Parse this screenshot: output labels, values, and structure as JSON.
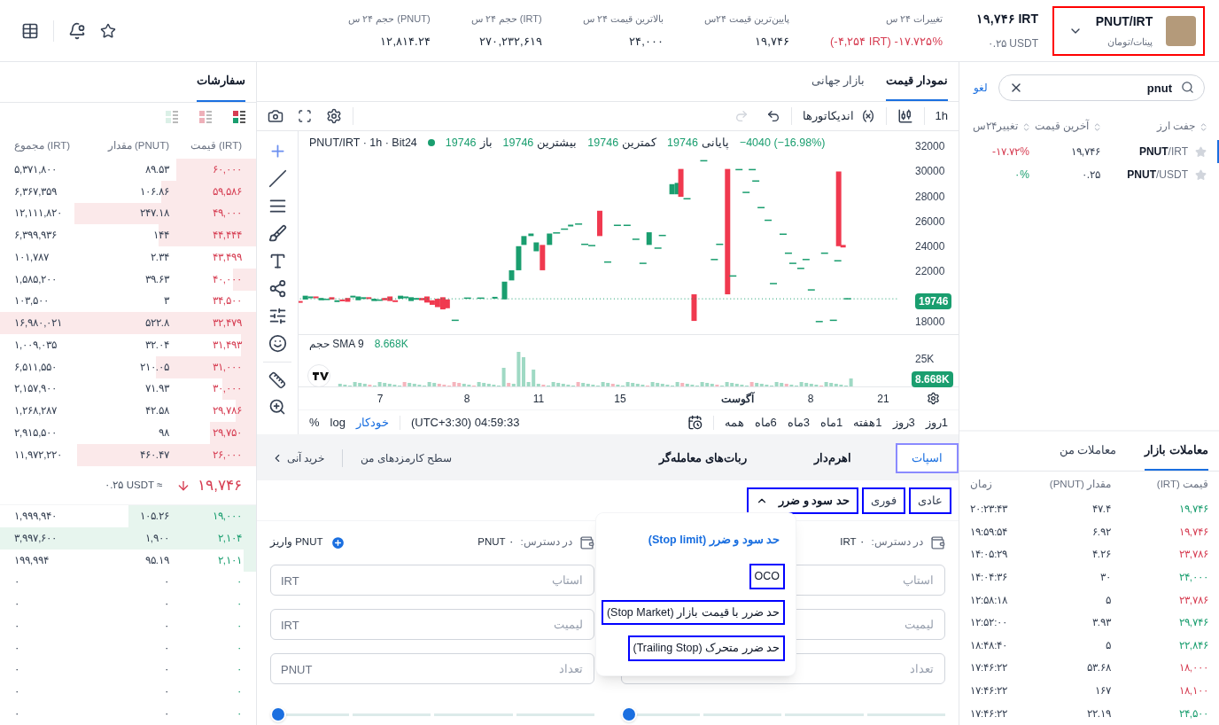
{
  "header": {
    "pair": {
      "symbol": "PNUT/IRT",
      "name": "پینات/تومان",
      "highlighted": true
    },
    "price": "۱۹,۷۴۶ IRT",
    "price_usdt": "۰.۲۵ USDT",
    "stats": [
      {
        "label": "تغییرات ۲۴ س",
        "value": "(-۴,۲۵۴ IRT) -۱۷.۷۲۵%",
        "negative": true
      },
      {
        "label": "پایین‌ترین قیمت ۲۴س",
        "value": "۱۹,۷۴۶",
        "negative": false
      },
      {
        "label": "بالاترین قیمت ۲۴ س",
        "value": "۲۴,۰۰۰",
        "negative": false
      },
      {
        "label": "حجم ۲۴ س (IRT)",
        "value": "۲۷۰,۲۳۲,۶۱۹",
        "negative": false
      },
      {
        "label": "حجم ۲۴ س (PNUT)",
        "value": "۱۲,۸۱۴.۲۴",
        "negative": false
      }
    ]
  },
  "order_book": {
    "tab": "سفارشات",
    "view_modes": [
      {
        "kind": "both",
        "selected": true
      },
      {
        "kind": "asks",
        "selected": false
      },
      {
        "kind": "bids",
        "selected": false
      }
    ],
    "columns": [
      "قیمت (IRT)",
      "مقدار (PNUT)",
      "مجموع (IRT)"
    ],
    "asks": [
      {
        "price": "۶۰,۰۰۰",
        "amount": "۸۹.۵۳",
        "total": "۵,۳۷۱,۸۰۰",
        "level": 0.31
      },
      {
        "price": "۵۹,۵۸۶",
        "amount": "۱۰۶.۸۶",
        "total": "۶,۳۶۷,۳۵۹",
        "level": 0.37
      },
      {
        "price": "۴۹,۰۰۰",
        "amount": "۲۴۷.۱۸",
        "total": "۱۲,۱۱۱,۸۲۰",
        "level": 0.71
      },
      {
        "price": "۴۴,۴۴۴",
        "amount": "۱۴۴",
        "total": "۶,۳۹۹,۹۳۶",
        "level": 0.38
      },
      {
        "price": "۴۳,۴۹۹",
        "amount": "۲.۳۴",
        "total": "۱۰۱,۷۸۷"
      },
      {
        "price": "۴۰,۰۰۰",
        "amount": "۳۹.۶۳",
        "total": "۱,۵۸۵,۲۰۰",
        "level": 0.09
      },
      {
        "price": "۳۴,۵۰۰",
        "amount": "۳",
        "total": "۱۰۳,۵۰۰"
      },
      {
        "price": "۳۲,۴۷۹",
        "amount": "۵۲۲.۸",
        "total": "۱۶,۹۸۰,۰۲۱",
        "level": 1
      },
      {
        "price": "۳۱,۴۹۳",
        "amount": "۳۲.۰۴",
        "total": "۱,۰۰۹,۰۳۵",
        "level": 0.06
      },
      {
        "price": "۳۱,۰۰۰",
        "amount": "۲۱۰.۰۵",
        "total": "۶,۵۱۱,۵۵۰",
        "level": 0.39
      },
      {
        "price": "۳۰,۰۰۰",
        "amount": "۷۱.۹۳",
        "total": "۲,۱۵۷,۹۰۰",
        "level": 0.13
      },
      {
        "price": "۲۹,۷۸۶",
        "amount": "۴۲.۵۸",
        "total": "۱,۲۶۸,۲۸۷",
        "level": 0.08
      },
      {
        "price": "۲۹,۷۵۰",
        "amount": "۹۸",
        "total": "۲,۹۱۵,۵۰۰",
        "level": 0.18
      },
      {
        "price": "۲۶,۰۰۰",
        "amount": "۴۶۰.۴۷",
        "total": "۱۱,۹۷۲,۲۲۰",
        "level": 0.7
      }
    ],
    "last_price": "۱۹,۷۴۶",
    "last_price_falling": true,
    "last_price_usdt": "۰.۲۵ USDT ≈",
    "bids": [
      {
        "price": "۱۹,۰۰۰",
        "amount": "۱۰۵.۲۶",
        "total": "۱,۹۹۹,۹۴۰",
        "level": 0.5
      },
      {
        "price": "۲,۱۰۴",
        "amount": "۱,۹۰۰",
        "total": "۳,۹۹۷,۶۰۰",
        "level": 1
      },
      {
        "price": "۲,۱۰۱",
        "amount": "۹۵.۱۹",
        "total": "۱۹۹,۹۹۴",
        "level": 0.05
      },
      {
        "price": "۰",
        "amount": "۰",
        "total": "۰"
      },
      {
        "price": "۰",
        "amount": "۰",
        "total": "۰"
      },
      {
        "price": "۰",
        "amount": "۰",
        "total": "۰"
      },
      {
        "price": "۰",
        "amount": "۰",
        "total": "۰"
      },
      {
        "price": "۰",
        "amount": "۰",
        "total": "۰"
      },
      {
        "price": "۰",
        "amount": "۰",
        "total": "۰"
      },
      {
        "price": "۰",
        "amount": "۰",
        "total": "۰"
      }
    ]
  },
  "chart_panel": {
    "tabs": [
      {
        "label": "نمودار قیمت",
        "selected": true
      },
      {
        "label": "بازار جهانی",
        "selected": false
      }
    ],
    "interval": "1h",
    "indicators": "اندیکاتورها",
    "title": "PNUT/IRT · 1h · Bit24",
    "change": "−4040 (−16.98%)",
    "ohlc": [
      {
        "label": "پایانی",
        "value": "19746"
      },
      {
        "label": "کمترین",
        "value": "19746"
      },
      {
        "label": "بیشترین",
        "value": "19746"
      },
      {
        "label": "باز",
        "value": "19746"
      }
    ],
    "price_axis": [
      "32000",
      "30000",
      "28000",
      "26000",
      "24000",
      "22000",
      "18000"
    ],
    "current_price": "19746",
    "volume_legend": "حجم SMA 9",
    "volume_value": "8.668K",
    "volume_axis": "25K",
    "volume_tag": "8.668K",
    "time_axis": [
      "21",
      "8",
      "آگوست",
      "15",
      "11",
      "8",
      "7"
    ],
    "ranges": [
      "1روز",
      "3روز",
      "1هفته",
      "1ماه",
      "3ماه",
      "6ماه",
      "همه"
    ],
    "clock": "(UTC+3:30) 04:59:33",
    "scale_options": [
      {
        "label": "خودکار",
        "selected": true
      },
      {
        "label": "log",
        "selected": false
      },
      {
        "label": "%",
        "selected": false
      }
    ]
  },
  "trade_panel": {
    "tabs": [
      {
        "label": "اسپات",
        "selected": true,
        "highlighted": true
      },
      {
        "label": "اهرم‌دار",
        "selected": false,
        "highlighted": false
      },
      {
        "label": "ربات‌های معامله‌گر",
        "selected": false,
        "highlighted": false
      }
    ],
    "links": [
      {
        "label": "سطح کارمزدهای من",
        "kind": "plain"
      },
      {
        "label": "خرید آنی",
        "kind": "arrow"
      }
    ],
    "order_types": [
      {
        "label": "عادی",
        "selected": false,
        "highlighted": true,
        "kind": "tab"
      },
      {
        "label": "فوری",
        "selected": false,
        "highlighted": true,
        "kind": "tab"
      },
      {
        "label": "حد سود و ضرر",
        "selected": true,
        "highlighted": true,
        "kind": "dropdown",
        "expanded": true
      }
    ],
    "order_menu": [
      {
        "label": "حد سود و ضرر (Stop limit)",
        "selected": true,
        "highlighted": false
      },
      {
        "label": "OCO",
        "selected": false,
        "highlighted": true
      },
      {
        "label": "حد ضرر با قیمت بازار (Stop Market)",
        "selected": false,
        "highlighted": true
      },
      {
        "label": "حد ضرر متحرک (Trailing Stop)",
        "selected": false,
        "highlighted": true
      }
    ],
    "forms": [
      {
        "available_label": "در دسترس:",
        "available": "IRT ۰",
        "fields": [
          {
            "placeholder": "استاپ"
          },
          {
            "placeholder": "لیمیت"
          },
          {
            "placeholder": "تعداد"
          }
        ],
        "level": 0
      },
      {
        "available_label": "در دسترس:",
        "available": "PNUT ۰",
        "deposit": "واریز PNUT",
        "fields": [
          {
            "placeholder": "استاپ",
            "unit": "IRT"
          },
          {
            "placeholder": "لیمیت",
            "unit": "IRT"
          },
          {
            "placeholder": "تعداد",
            "unit": "PNUT"
          }
        ],
        "level": 0
      }
    ]
  },
  "markets": {
    "search": {
      "value": "pnut"
    },
    "cancel": "لغو",
    "columns": [
      "جفت ارز",
      "آخرین قیمت",
      "تغییر۲۴س"
    ],
    "rows": [
      {
        "base": "PNUT",
        "quote": "/IRT",
        "price": "۱۹,۷۴۶",
        "change": "-۱۷.۷۲%",
        "negative": true,
        "selected": true
      },
      {
        "base": "PNUT",
        "quote": "/USDT",
        "price": "۰.۲۵",
        "change": "۰%",
        "negative": false,
        "selected": false
      }
    ]
  },
  "trades": {
    "tabs": [
      {
        "label": "معاملات بازار",
        "selected": true
      },
      {
        "label": "معاملات من",
        "selected": false
      }
    ],
    "columns": [
      "قیمت (IRT)",
      "مقدار (PNUT)",
      "زمان"
    ],
    "rows": [
      {
        "price": "۱۹,۷۴۶",
        "amount": "۴۷.۴",
        "time": "۲۰:۲۳:۴۳",
        "sell": false
      },
      {
        "price": "۱۹,۷۴۶",
        "amount": "۶.۹۲",
        "time": "۱۹:۵۹:۵۴",
        "sell": true
      },
      {
        "price": "۲۳,۷۸۶",
        "amount": "۴.۲۶",
        "time": "۱۴:۰۵:۲۹",
        "sell": true
      },
      {
        "price": "۲۴,۰۰۰",
        "amount": "۳۰",
        "time": "۱۴:۰۴:۳۶",
        "sell": false
      },
      {
        "price": "۲۳,۷۸۶",
        "amount": "۵",
        "time": "۱۲:۵۸:۱۸",
        "sell": true
      },
      {
        "price": "۲۹,۷۴۶",
        "amount": "۳.۹۳",
        "time": "۱۲:۵۲:۰۰",
        "sell": false
      },
      {
        "price": "۲۲,۸۴۶",
        "amount": "۵",
        "time": "۱۸:۴۸:۴۰",
        "sell": false
      },
      {
        "price": "۱۸,۰۰۰",
        "amount": "۵۳.۶۸",
        "time": "۱۷:۴۶:۲۲",
        "sell": true
      },
      {
        "price": "۱۸,۱۰۰",
        "amount": "۱۶۷",
        "time": "۱۷:۴۶:۲۲",
        "sell": true
      },
      {
        "price": "۲۴,۵۰۰",
        "amount": "۲۲.۱۹",
        "time": "۱۷:۴۶:۲۲",
        "sell": false
      }
    ]
  }
}
